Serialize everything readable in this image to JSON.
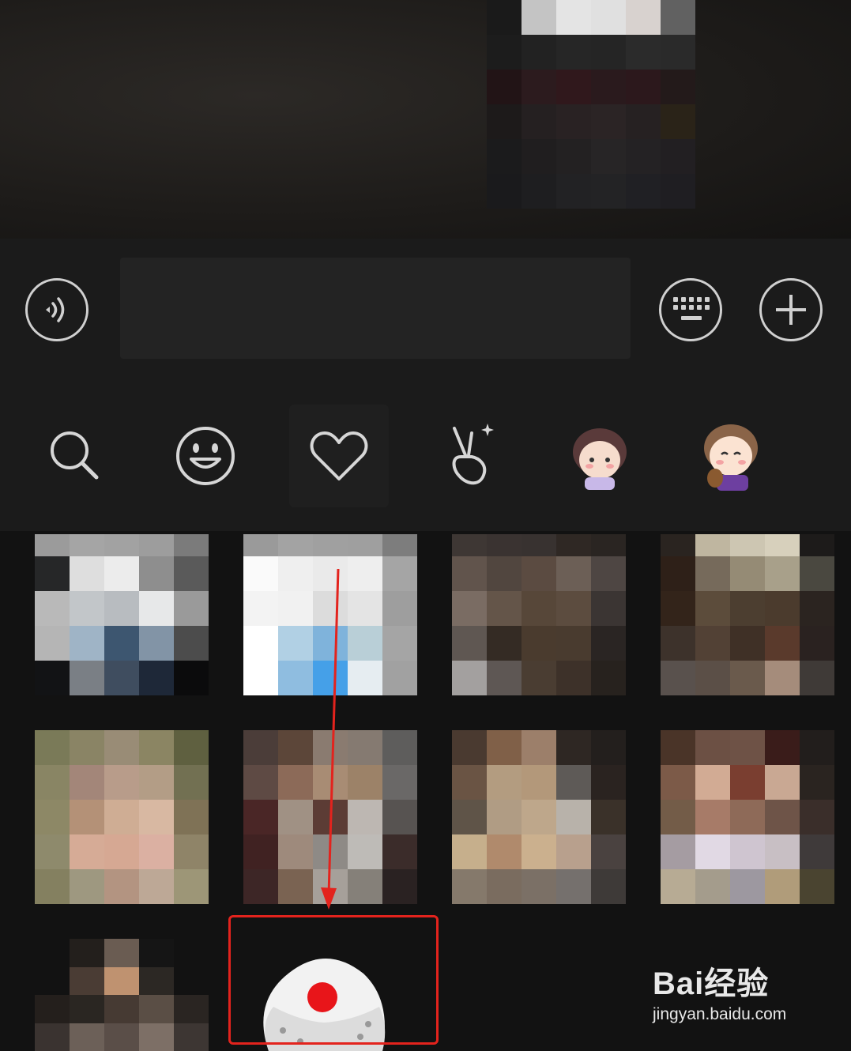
{
  "composer": {
    "voice_icon": "voice-wave-icon",
    "keyboard_icon": "keyboard-icon",
    "plus_icon": "plus-icon",
    "input_value": "",
    "input_placeholder": ""
  },
  "emoji_tabs": [
    {
      "name": "search",
      "icon": "search-icon"
    },
    {
      "name": "emoji",
      "icon": "smiley-icon"
    },
    {
      "name": "favorites",
      "icon": "heart-icon",
      "active": true
    },
    {
      "name": "gestures",
      "icon": "peace-hand-icon"
    },
    {
      "name": "sticker-pack-1",
      "icon": "cartoon-sticker-icon"
    },
    {
      "name": "sticker-pack-2",
      "icon": "cartoon-sticker-icon"
    }
  ],
  "highlight": {
    "color": "#e3231d",
    "target": "dice-sticker"
  },
  "watermark": {
    "logo": "Bai经验",
    "url": "jingyan.baidu.com"
  }
}
